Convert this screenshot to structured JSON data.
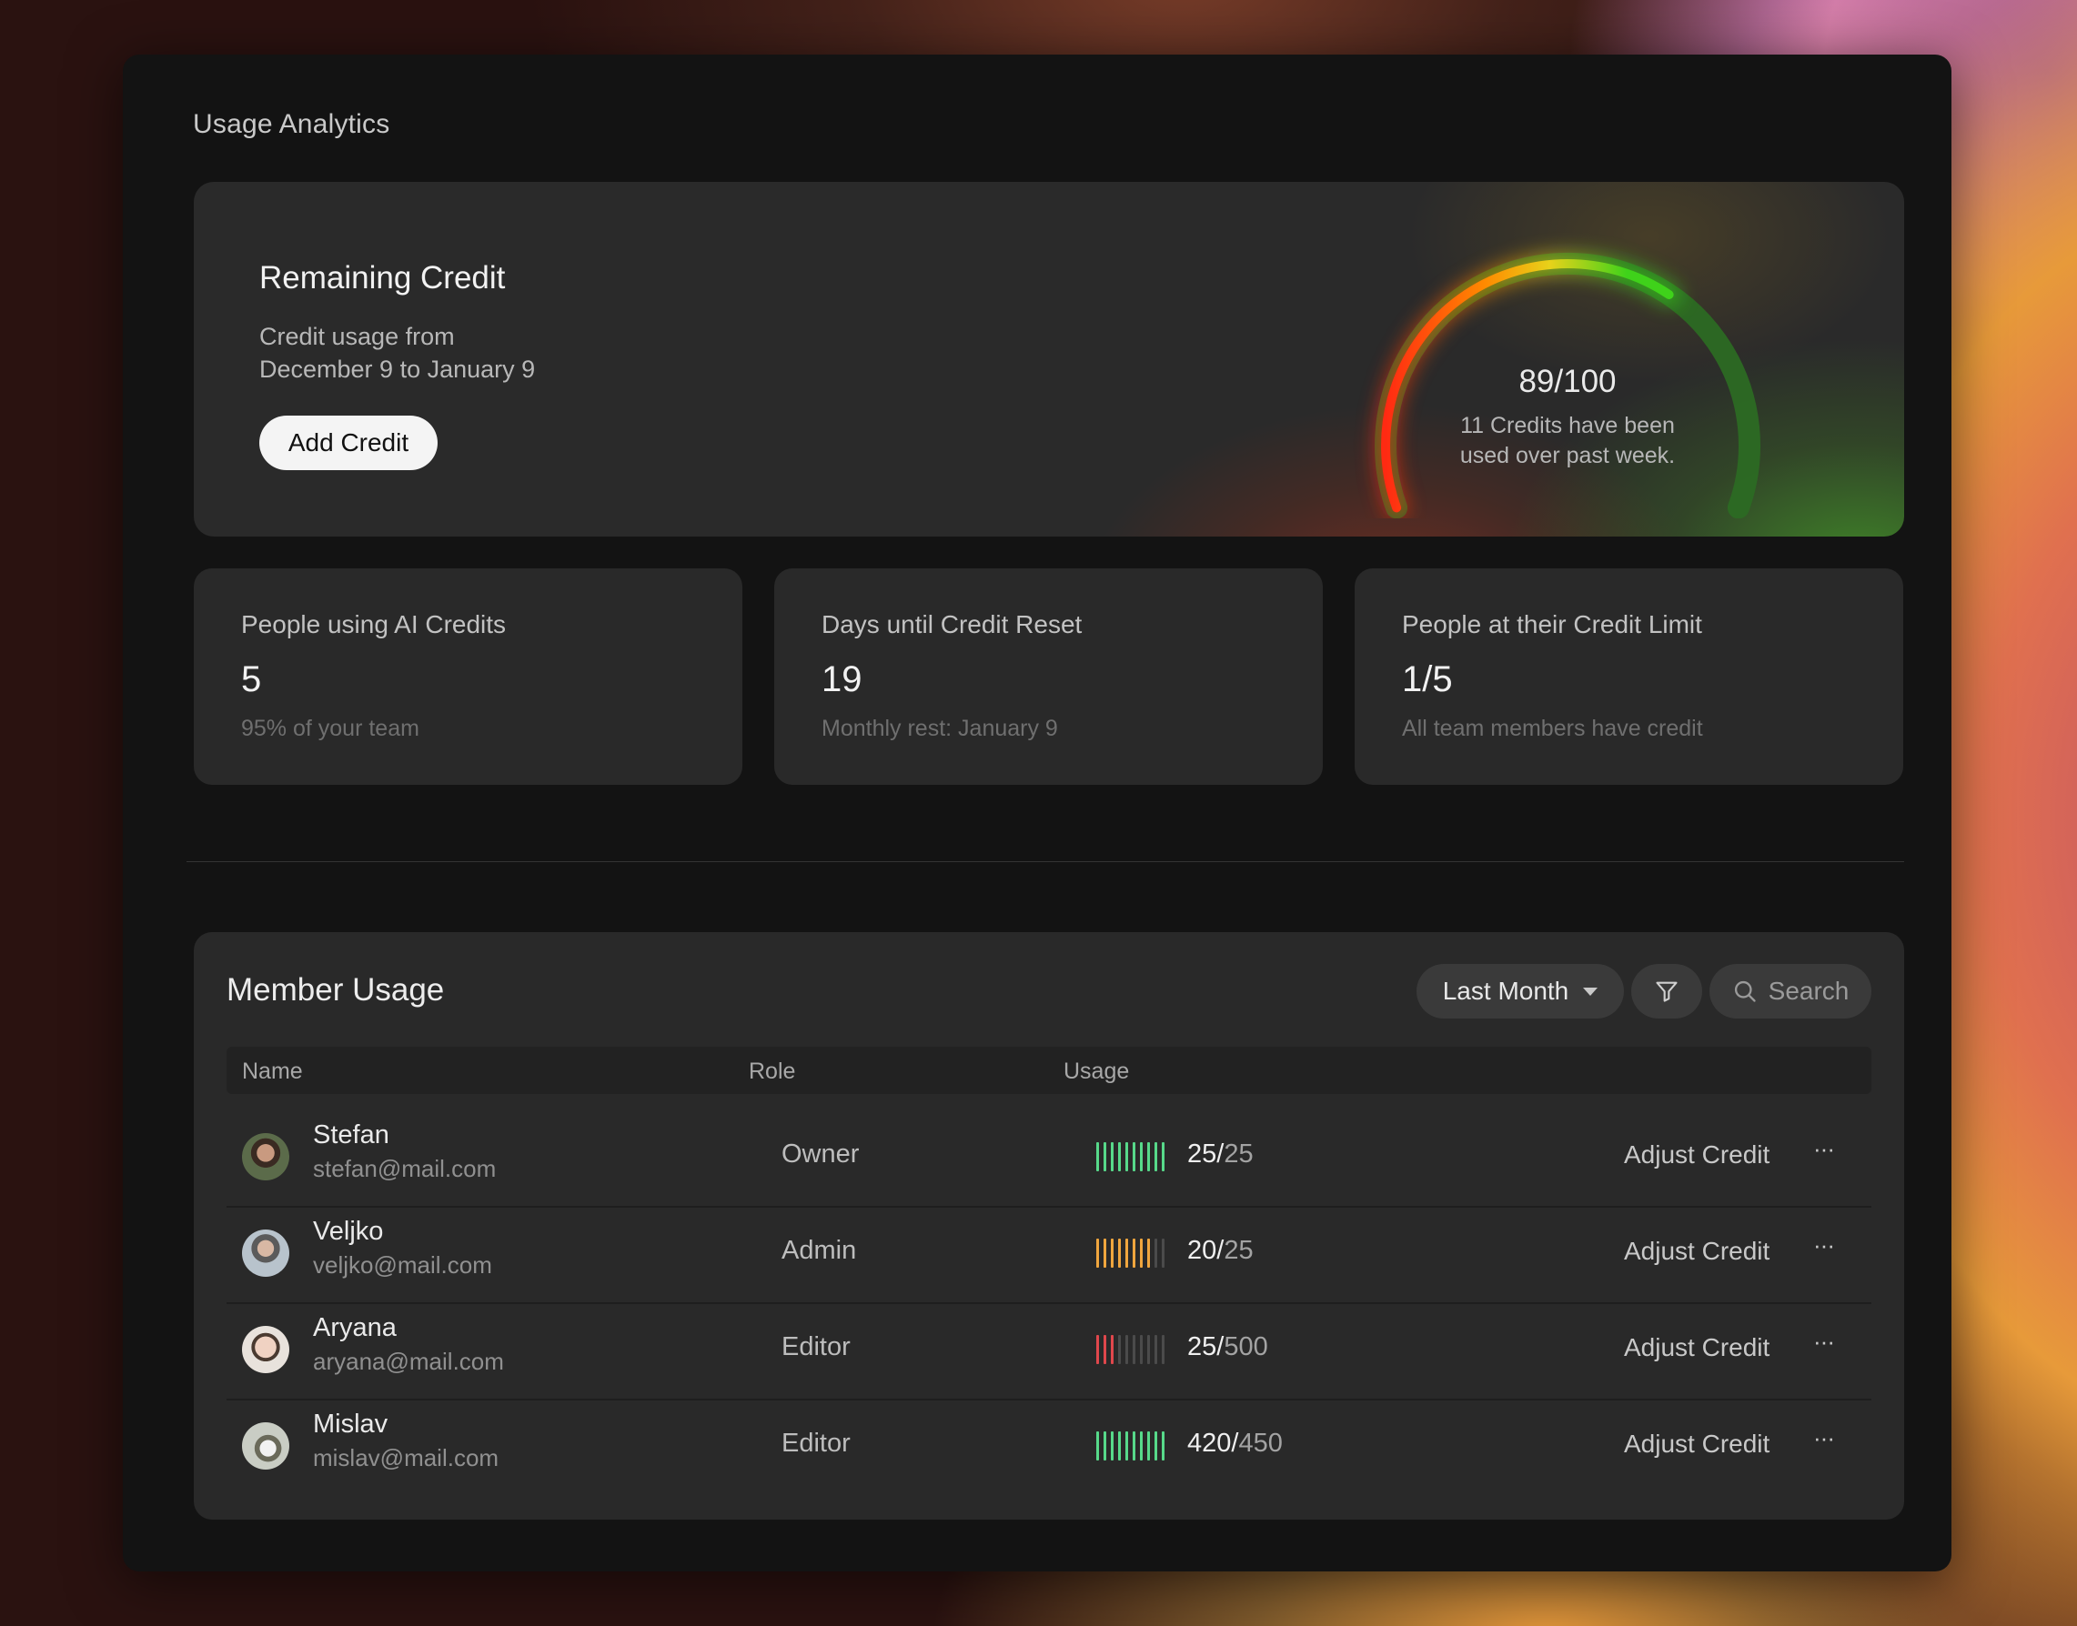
{
  "page": {
    "title": "Usage Analytics"
  },
  "remaining_credit": {
    "title": "Remaining Credit",
    "subtitle_line1": "Credit usage from",
    "subtitle_line2": "December 9 to January 9",
    "add_credit_label": "Add Credit",
    "gauge": {
      "value_label": "89/100",
      "used": 89,
      "total": 100,
      "caption_line1": "11 Credits have been",
      "caption_line2": "used over past week."
    }
  },
  "stats": [
    {
      "label": "People using AI Credits",
      "value": "5",
      "sub": "95% of your team"
    },
    {
      "label": "Days until Credit Reset",
      "value": "19",
      "sub": "Monthly rest: January 9"
    },
    {
      "label": "People at their Credit Limit",
      "value": "1/5",
      "sub": "All team members have credit"
    }
  ],
  "member_usage": {
    "title": "Member Usage",
    "period": "Last Month",
    "search_placeholder": "Search",
    "columns": {
      "name": "Name",
      "role": "Role",
      "usage": "Usage"
    },
    "action_label": "Adjust Credit",
    "more_label": "···",
    "members": [
      {
        "name": "Stefan",
        "email": "stefan@mail.com",
        "role": "Owner",
        "used": "25",
        "total": "25",
        "filled_bars": 10,
        "bar_color": "#57d98a"
      },
      {
        "name": "Veljko",
        "email": "veljko@mail.com",
        "role": "Admin",
        "used": "20",
        "total": "25",
        "filled_bars": 8,
        "bar_color": "#f0a63e"
      },
      {
        "name": "Aryana",
        "email": "aryana@mail.com",
        "role": "Editor",
        "used": "25",
        "total": "500",
        "filled_bars": 3,
        "bar_color": "#e0474c"
      },
      {
        "name": "Mislav",
        "email": "mislav@mail.com",
        "role": "Editor",
        "used": "420",
        "total": "450",
        "filled_bars": 10,
        "bar_color": "#57d98a"
      }
    ]
  },
  "colors": {
    "gauge_red": "#ff2a12",
    "gauge_orange": "#ff8a00",
    "gauge_yellow": "#e7d21a",
    "gauge_green": "#3fd21a",
    "gauge_track": "#2c6a23"
  }
}
